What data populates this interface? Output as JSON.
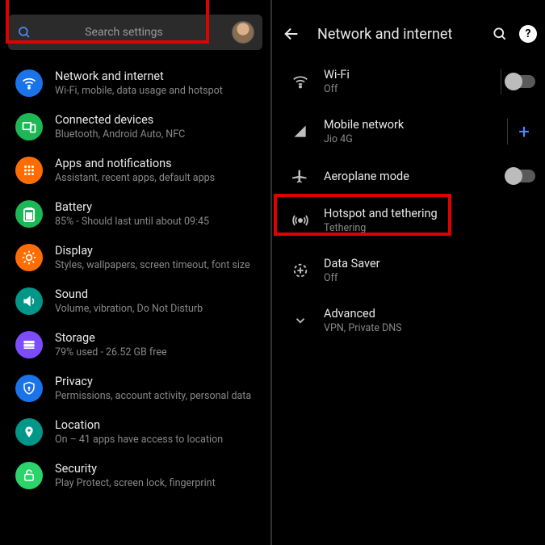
{
  "left": {
    "search_placeholder": "Search settings",
    "items": [
      {
        "title": "Network and internet",
        "sub": "Wi-Fi, mobile, data usage and hotspot",
        "highlight": true
      },
      {
        "title": "Connected devices",
        "sub": "Bluetooth, Android Auto, NFC"
      },
      {
        "title": "Apps and notifications",
        "sub": "Assistant, recent apps, default apps"
      },
      {
        "title": "Battery",
        "sub": "85% - Should last until about 09:45"
      },
      {
        "title": "Display",
        "sub": "Styles, wallpapers, screen timeout, font size"
      },
      {
        "title": "Sound",
        "sub": "Volume, vibration, Do Not Disturb"
      },
      {
        "title": "Storage",
        "sub": "79% used - 26.52 GB free"
      },
      {
        "title": "Privacy",
        "sub": "Permissions, account activity, personal data"
      },
      {
        "title": "Location",
        "sub": "On – 41 apps have access to location"
      },
      {
        "title": "Security",
        "sub": "Play Protect, screen lock, fingerprint"
      }
    ]
  },
  "right": {
    "header_title": "Network and internet",
    "items": [
      {
        "title": "Wi-Fi",
        "sub": "Off"
      },
      {
        "title": "Mobile network",
        "sub": "Jio 4G"
      },
      {
        "title": "Aeroplane mode"
      },
      {
        "title": "Hotspot and tethering",
        "sub": "Tethering",
        "highlight": true
      },
      {
        "title": "Data Saver",
        "sub": "Off"
      },
      {
        "title": "Advanced",
        "sub": "VPN, Private DNS"
      }
    ]
  }
}
